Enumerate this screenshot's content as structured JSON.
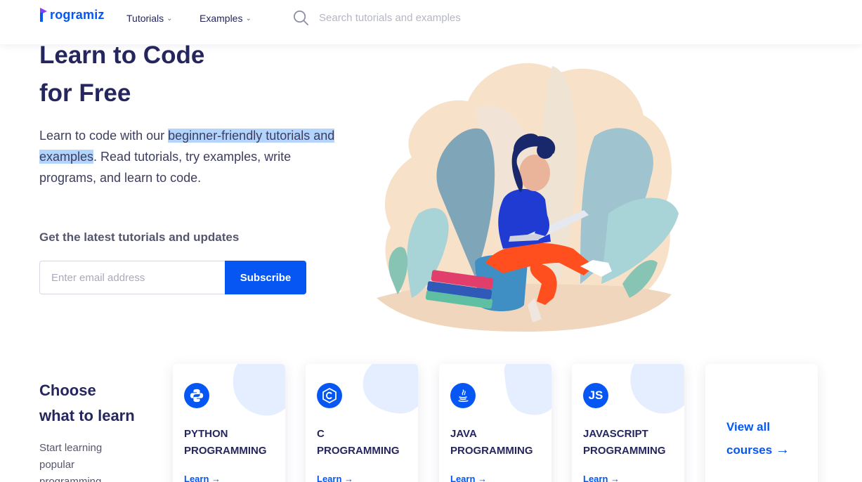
{
  "header": {
    "logo_text": "rogramiz",
    "nav": [
      {
        "label": "Tutorials"
      },
      {
        "label": "Examples"
      }
    ],
    "search_placeholder": "Search tutorials and examples"
  },
  "hero": {
    "title_line1": "Learn to Code",
    "title_line2": "for Free",
    "desc_before": "Learn to code with our ",
    "desc_highlight": "beginner-friendly tutorials and examples",
    "desc_after": ". Read tutorials, try examples, write programs, and learn to code."
  },
  "newsletter": {
    "label": "Get the latest tutorials and updates",
    "email_placeholder": "Enter email address",
    "button": "Subscribe"
  },
  "courses": {
    "title_line1": "Choose",
    "title_line2": "what to learn",
    "desc": "Start learning popular programming",
    "cards": [
      {
        "title_line1": "PYTHON",
        "title_line2": "PROGRAMMING",
        "link": "Learn",
        "icon": "python-icon"
      },
      {
        "title_line1": "C",
        "title_line2": "PROGRAMMING",
        "link": "Learn",
        "icon": "c-icon"
      },
      {
        "title_line1": "JAVA",
        "title_line2": "PROGRAMMING",
        "link": "Learn",
        "icon": "java-icon"
      },
      {
        "title_line1": "JAVASCRIPT",
        "title_line2": "PROGRAMMING",
        "link": "Learn",
        "icon": "js-icon"
      }
    ],
    "view_all_line1": "View all",
    "view_all_line2": "courses"
  },
  "colors": {
    "brand": "#0556f3",
    "text": "#25265e",
    "highlight": "#b3d4fc"
  }
}
